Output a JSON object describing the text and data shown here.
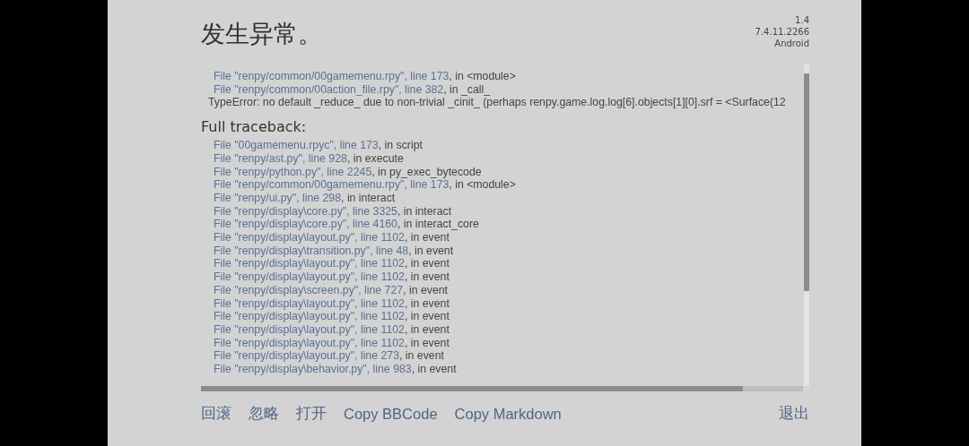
{
  "title": "发生异常。",
  "version": [
    "1.4",
    "7.4.11.2266",
    "Android"
  ],
  "short_traceback": [
    {
      "kind": "frame",
      "file": "File \"renpy/common/00gamemenu.rpy\"",
      "line": ", line 173",
      "func": ", in <module>"
    },
    {
      "kind": "frame",
      "file": "File \"renpy/common/00action_file.rpy\"",
      "line": ", line 382",
      "func": ", in _call_"
    },
    {
      "kind": "error",
      "text": "TypeError: no default _reduce_ due to non-trivial _cinit_ (perhaps renpy.game.log.log[6].objects[1][0].srf = <Surface(12"
    }
  ],
  "full_traceback_heading": "Full traceback:",
  "full_traceback": [
    {
      "kind": "frame",
      "file": "File \"00gamemenu.rpyc\"",
      "line": ", line 173",
      "func": ", in script"
    },
    {
      "kind": "frame",
      "file": "File \"renpy/ast.py\"",
      "line": ", line 928",
      "func": ", in execute"
    },
    {
      "kind": "frame",
      "file": "File \"renpy/python.py\"",
      "line": ", line 2245",
      "func": ", in py_exec_bytecode"
    },
    {
      "kind": "frame",
      "file": "File \"renpy/common/00gamemenu.rpy\"",
      "line": ", line 173",
      "func": ", in <module>"
    },
    {
      "kind": "frame",
      "file": "File \"renpy/ui.py\"",
      "line": ", line 298",
      "func": ", in interact"
    },
    {
      "kind": "frame",
      "file": "File \"renpy/display\\core.py\"",
      "line": ", line 3325",
      "func": ", in interact"
    },
    {
      "kind": "frame",
      "file": "File \"renpy/display\\core.py\"",
      "line": ", line 4160",
      "func": ", in interact_core"
    },
    {
      "kind": "frame",
      "file": "File \"renpy/display\\layout.py\"",
      "line": ", line 1102",
      "func": ", in event"
    },
    {
      "kind": "frame",
      "file": "File \"renpy/display\\transition.py\"",
      "line": ", line 48",
      "func": ", in event"
    },
    {
      "kind": "frame",
      "file": "File \"renpy/display\\layout.py\"",
      "line": ", line 1102",
      "func": ", in event"
    },
    {
      "kind": "frame",
      "file": "File \"renpy/display\\layout.py\"",
      "line": ", line 1102",
      "func": ", in event"
    },
    {
      "kind": "frame",
      "file": "File \"renpy/display\\screen.py\"",
      "line": ", line 727",
      "func": ", in event"
    },
    {
      "kind": "frame",
      "file": "File \"renpy/display\\layout.py\"",
      "line": ", line 1102",
      "func": ", in event"
    },
    {
      "kind": "frame",
      "file": "File \"renpy/display\\layout.py\"",
      "line": ", line 1102",
      "func": ", in event"
    },
    {
      "kind": "frame",
      "file": "File \"renpy/display\\layout.py\"",
      "line": ", line 1102",
      "func": ", in event"
    },
    {
      "kind": "frame",
      "file": "File \"renpy/display\\layout.py\"",
      "line": ", line 1102",
      "func": ", in event"
    },
    {
      "kind": "frame",
      "file": "File \"renpy/display\\layout.py\"",
      "line": ", line 273",
      "func": ", in event"
    },
    {
      "kind": "frame",
      "file": "File \"renpy/display\\behavior.py\"",
      "line": ", line 983",
      "func": ", in event"
    }
  ],
  "actions": [
    "回滚",
    "忽略",
    "打开",
    "Copy BBCode",
    "Copy Markdown"
  ],
  "quit": "退出"
}
